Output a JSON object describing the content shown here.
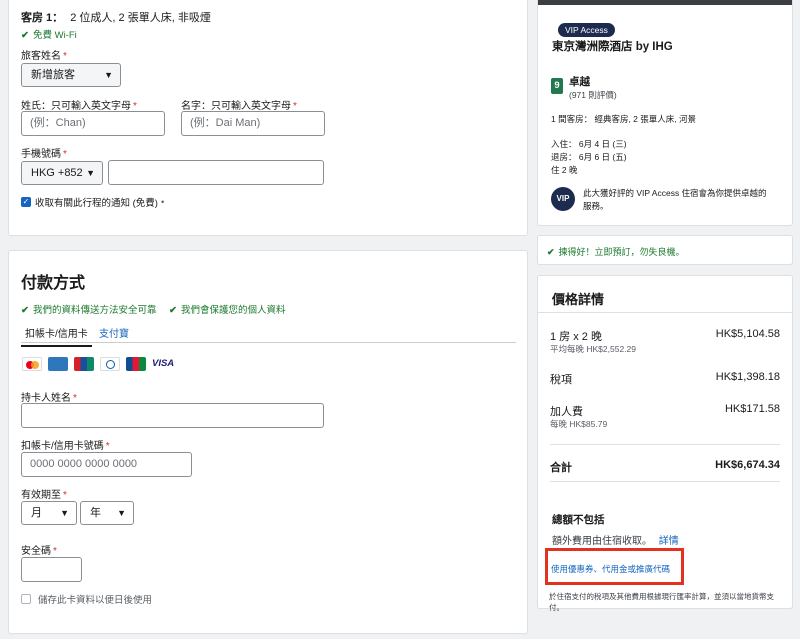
{
  "room": {
    "label": "客房 1：",
    "desc": "2 位成人, 2 張單人床, 非吸煙",
    "wifi": "免費 Wi-Fi"
  },
  "guest": {
    "name_label": "旅客姓名",
    "name_select": "新增旅客",
    "surname_label": "姓氏：只可輸入英文字母",
    "surname_placeholder": "(例：Chan)",
    "given_label": "名字：只可輸入英文字母",
    "given_placeholder": "(例：Dai Man)",
    "phone_label": "手機號碼",
    "phone_code": "HKG +852",
    "notify_label": "收取有關此行程的通知 (免費)",
    "notify_suffix": "•"
  },
  "payment": {
    "title": "付款方式",
    "assure1": "我們的資料傳送方法安全可靠",
    "assure2": "我們會保護您的個人資料",
    "tabs": [
      "扣帳卡/信用卡",
      "支付寶"
    ],
    "cards": [
      "MC",
      "AMEX",
      "UnionPay",
      "Diners",
      "JCB",
      "VISA"
    ],
    "holder_label": "持卡人姓名",
    "number_label": "扣帳卡/信用卡號碼",
    "number_placeholder": "0000 0000 0000 0000",
    "expiry_label": "有效期至",
    "month": "月",
    "year": "年",
    "cvv_label": "安全碼",
    "save_label": "儲存此卡資料以便日後使用"
  },
  "hotel": {
    "badge": "VIP Access",
    "name": "東京灣洲際酒店 by IHG",
    "score": "9",
    "rating": "卓越",
    "reviews": "(971 則評價)",
    "room": "1 間客房： 經典客房, 2 張單人床, 河景",
    "checkin": "入住： 6月 4 日 (三)",
    "checkout": "退房： 6月 6 日 (五)",
    "nights": "住 2 晚",
    "vip_icon": "VIP",
    "vip_text": "此大獲好評的 VIP Access 住宿會為你提供卓越的服務。"
  },
  "deal": {
    "text": "揀得好！立即預訂，勿失良機。"
  },
  "price": {
    "title": "價格詳情",
    "room_line": "1 房 x 2 晚",
    "room_amount": "HK$5,104.58",
    "avg": "平均每晚 HK$2,552.29",
    "tax_label": "稅項",
    "tax_amount": "HK$1,398.18",
    "extra_label": "加人費",
    "extra_amount": "HK$171.58",
    "extra_sub": "每晚 HK$85.79",
    "total_label": "合計",
    "total_amount": "HK$6,674.34",
    "excluded_title": "總額不包括",
    "excluded_text": "額外費用由住宿收取。",
    "details_link": "詳情",
    "coupon_link": "使用優惠券、代用金或推廣代碼",
    "footnote": "於住宿支付的稅項及其他費用根據現行匯率計算，並須以當地貨幣支付。"
  }
}
